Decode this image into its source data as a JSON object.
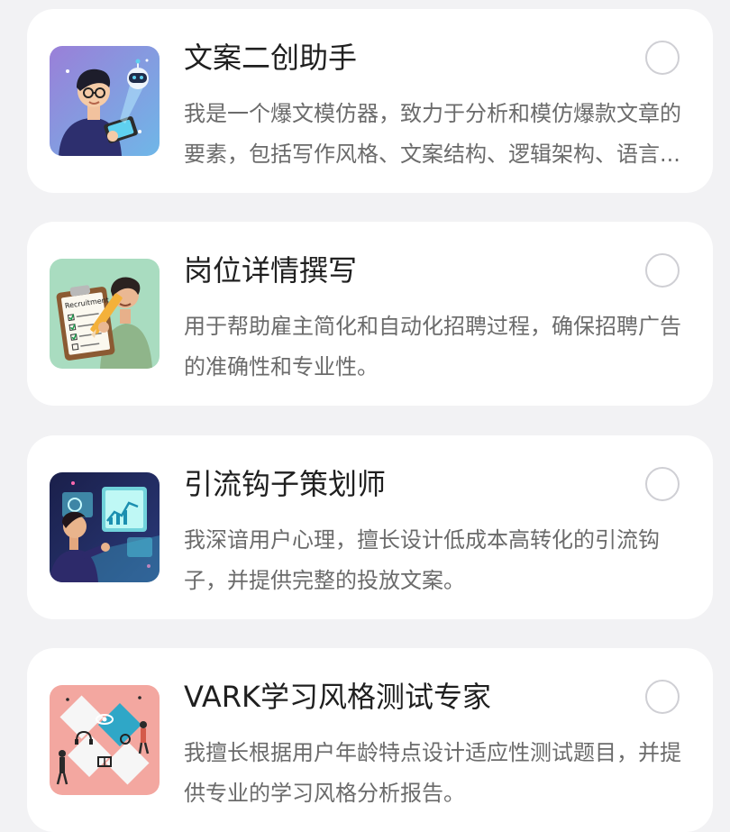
{
  "assistants": [
    {
      "title": "文案二创助手",
      "description": "我是一个爆文模仿器，致力于分析和模仿爆款文章的要素，包括写作风格、文案结构、逻辑架构、语言...",
      "selected": false,
      "avatar_icon": "person-with-tablet-and-robot-icon"
    },
    {
      "title": "岗位详情撰写",
      "description": "用于帮助雇主简化和自动化招聘过程，确保招聘广告的准确性和专业性。",
      "selected": false,
      "avatar_icon": "recruitment-clipboard-icon",
      "avatar_text": "Recruitment"
    },
    {
      "title": "引流钩子策划师",
      "description": "我深谙用户心理，擅长设计低成本高转化的引流钩子，并提供完整的投放文案。",
      "selected": false,
      "avatar_icon": "analytics-screen-icon"
    },
    {
      "title": "VARK学习风格测试专家",
      "description": "我擅长根据用户年龄特点设计适应性测试题目，并提供专业的学习风格分析报告。",
      "selected": false,
      "avatar_icon": "puzzle-learning-styles-icon"
    }
  ],
  "colors": {
    "background": "#f2f2f4",
    "card": "#ffffff",
    "title": "#1f1f1f",
    "description": "#6b6b6b",
    "radio_border": "#cfcfd4"
  }
}
